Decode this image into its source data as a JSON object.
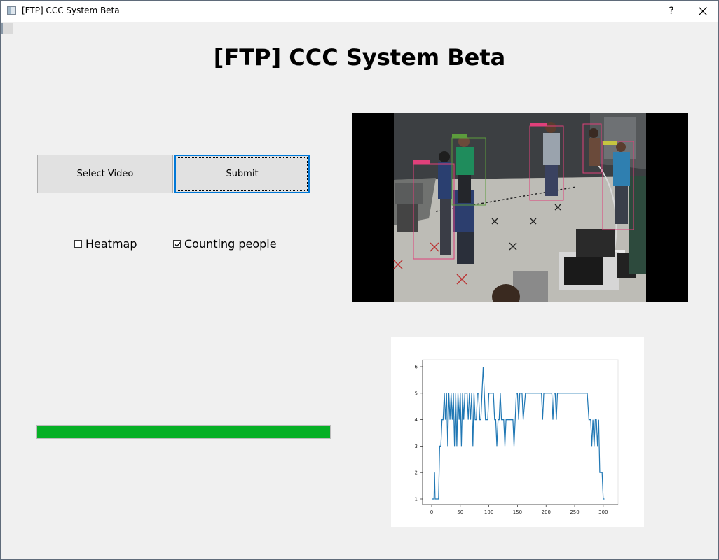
{
  "window": {
    "title": "[FTP] CCC System Beta",
    "help_label": "?",
    "close_icon": "close-icon"
  },
  "page": {
    "heading": "[FTP] CCC System Beta"
  },
  "buttons": {
    "select_video": "Select Video",
    "submit": "Submit"
  },
  "options": {
    "heatmap": {
      "label": "Heatmap",
      "checked": false
    },
    "counting_people": {
      "label": "Counting people",
      "checked": true
    }
  },
  "video": {
    "detections": [
      {
        "label": "person"
      },
      {
        "label": "person"
      },
      {
        "label": "person"
      },
      {
        "label": "person"
      }
    ]
  },
  "progress": {
    "value": 1.0,
    "color": "#06b025"
  },
  "chart_data": {
    "type": "line",
    "title": "",
    "xlabel": "",
    "ylabel": "",
    "xlim": [
      0,
      310
    ],
    "ylim": [
      1,
      6
    ],
    "xticks": [
      0,
      50,
      100,
      150,
      200,
      250,
      300
    ],
    "yticks": [
      1,
      2,
      3,
      4,
      5,
      6
    ],
    "grid": false,
    "color": "#1f77b4",
    "series": [
      {
        "x": [
          0,
          4,
          5,
          6,
          7,
          8,
          10,
          12,
          14,
          16,
          18,
          20,
          22,
          24,
          26,
          28,
          30,
          32,
          34,
          36,
          38,
          40,
          42,
          44,
          46,
          48,
          50,
          52,
          54,
          56,
          58,
          60,
          62,
          64,
          66,
          68,
          70,
          72,
          74,
          76,
          78,
          80,
          82,
          84,
          86,
          88,
          90,
          92,
          94,
          96,
          98,
          100,
          104,
          108,
          110,
          112,
          114,
          116,
          118,
          120,
          122,
          124,
          126,
          128,
          130,
          132,
          134,
          136,
          138,
          140,
          142,
          144,
          146,
          148,
          150,
          152,
          154,
          156,
          158,
          160,
          164,
          168,
          172,
          176,
          180,
          184,
          188,
          190,
          192,
          194,
          196,
          198,
          200,
          204,
          208,
          210,
          212,
          214,
          216,
          218,
          220,
          224,
          228,
          232,
          236,
          240,
          244,
          248,
          252,
          256,
          260,
          264,
          268,
          272,
          275,
          278,
          280,
          282,
          284,
          286,
          288,
          290,
          292,
          294,
          296,
          298,
          300,
          302
        ],
        "y": [
          1,
          1,
          2,
          1,
          1,
          1,
          1,
          1,
          3,
          3,
          4,
          4,
          5,
          4,
          5,
          3,
          5,
          4,
          5,
          4,
          5,
          3,
          5,
          3,
          5,
          4,
          5,
          3,
          5,
          4,
          5,
          5,
          5,
          4,
          5,
          4,
          5,
          3,
          5,
          4,
          4,
          5,
          5,
          4,
          4,
          5,
          6,
          5,
          4,
          4,
          4,
          5,
          5,
          5,
          4,
          4,
          3,
          4,
          4,
          5,
          4,
          4,
          4,
          3,
          4,
          4,
          4,
          4,
          4,
          4,
          4,
          3,
          4,
          5,
          5,
          4,
          5,
          5,
          5,
          4,
          5,
          5,
          5,
          5,
          5,
          5,
          5,
          5,
          5,
          4,
          5,
          5,
          5,
          5,
          5,
          5,
          4,
          5,
          5,
          4,
          5,
          5,
          5,
          5,
          5,
          5,
          5,
          5,
          5,
          5,
          5,
          5,
          5,
          5,
          4,
          4,
          3,
          4,
          3,
          4,
          4,
          3,
          4,
          2,
          2,
          2,
          1,
          1
        ]
      }
    ]
  }
}
